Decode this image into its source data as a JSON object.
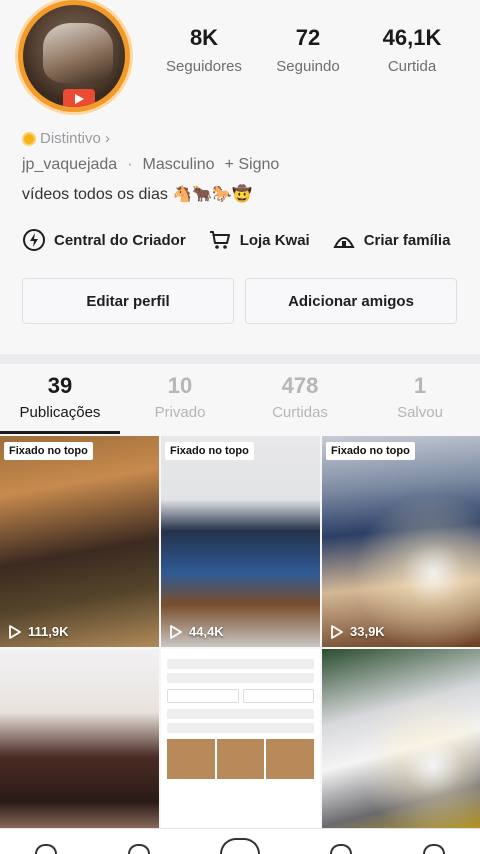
{
  "profile": {
    "stats": [
      {
        "value": "8K",
        "label": "Seguidores"
      },
      {
        "value": "72",
        "label": "Seguindo"
      },
      {
        "value": "46,1K",
        "label": "Curtida"
      }
    ],
    "distintivo": "Distintivo ›",
    "username": "jp_vaquejada",
    "gender": "Masculino",
    "signo": "+ Signo",
    "bio": "vídeos todos os dias 🐴🐂🐎🤠"
  },
  "quicklinks": [
    {
      "label": "Central do Criador",
      "icon": "lightning-icon"
    },
    {
      "label": "Loja Kwai",
      "icon": "cart-icon"
    },
    {
      "label": "Criar família",
      "icon": "tent-icon"
    }
  ],
  "actions": {
    "edit": "Editar perfil",
    "add": "Adicionar amigos"
  },
  "tabs": [
    {
      "count": "39",
      "label": "Publicações",
      "active": true
    },
    {
      "count": "10",
      "label": "Privado"
    },
    {
      "count": "478",
      "label": "Curtidas"
    },
    {
      "count": "1",
      "label": "Salvou"
    }
  ],
  "posts": [
    {
      "pinned": "Fixado no topo",
      "views": "111,9K"
    },
    {
      "pinned": "Fixado no topo",
      "views": "44,4K"
    },
    {
      "pinned": "Fixado no topo",
      "views": "33,9K"
    }
  ],
  "colors": {
    "avatar_ring": "#f39a2b",
    "active_tab": "#1a1a1a",
    "inactive_tab": "#b5b5ba"
  }
}
